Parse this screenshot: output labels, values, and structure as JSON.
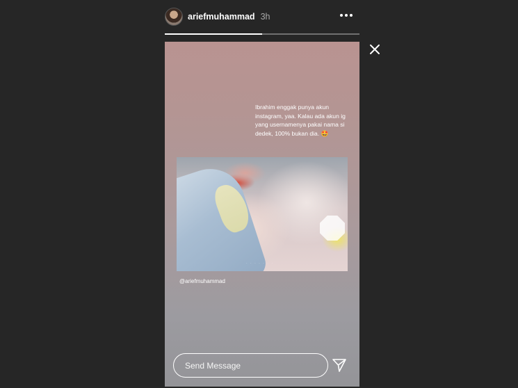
{
  "header": {
    "username": "ariefmuhammad",
    "time": "3h"
  },
  "progress": {
    "segments": 2,
    "filled_segments": 1
  },
  "story": {
    "caption": "Ibrahim enggak punya akun instagram, yaa. Kalau ada akun ig yang usernamenya pakai nama si dedek, 100% bukan dia. 🤩",
    "mention": "@ariefmuhammad"
  },
  "reply": {
    "placeholder": "Send Message"
  },
  "icons": {
    "more": "more-horizontal-icon",
    "close": "close-icon",
    "send": "send-paper-plane-icon"
  },
  "colors": {
    "background": "#262626",
    "text": "#ffffff",
    "muted": "#a8a8a8"
  }
}
